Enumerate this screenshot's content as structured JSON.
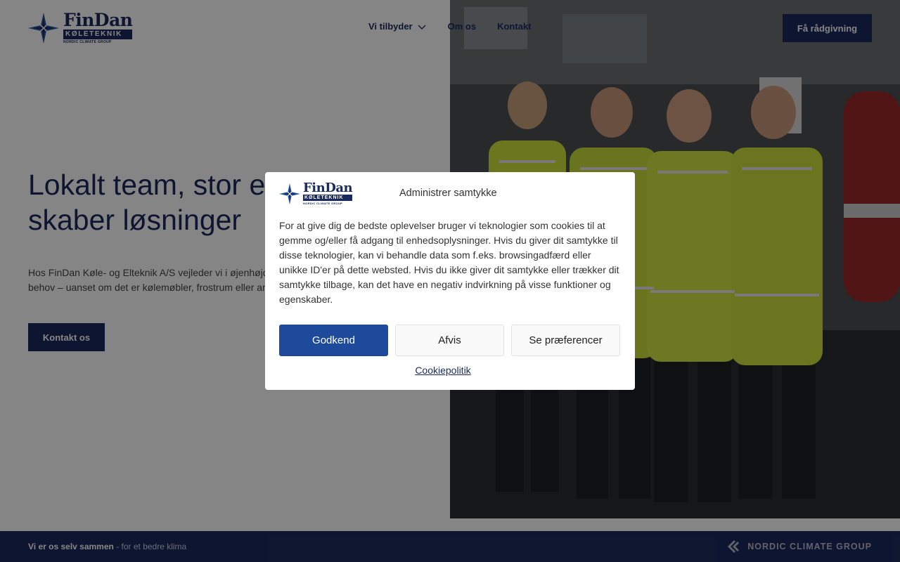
{
  "header": {
    "brand": "FinDan",
    "brand_sub": "KØLETEKNIK",
    "brand_group": "NORDIC CLIMATE GROUP",
    "nav": [
      {
        "label": "Vi tilbyder",
        "has_dropdown": true
      },
      {
        "label": "Om os"
      },
      {
        "label": "Kontakt"
      }
    ],
    "cta_label": "Få rådgivning"
  },
  "hero": {
    "title": "Lokalt team, stor erfaring – vi skaber løsninger",
    "text": "Hos FinDan Køle- og Elteknik A/S vejleder vi i øjenhøjde og finder den rette løsning til dit behov – uanset om det er kølemøbler, frostrum eller andre køleløsninger.",
    "button_label": "Kontakt os"
  },
  "footer": {
    "tagline_bold": "Vi er os selv sammen",
    "tagline_rest": " - for et bedre klima",
    "group_logo_text": "NORDIC CLIMATE GROUP"
  },
  "consent": {
    "title": "Administrer samtykke",
    "body": "For at give dig de bedste oplevelser bruger vi teknologier som cookies til at gemme og/eller få adgang til enhedsoplysninger. Hvis du giver dit samtykke til disse teknologier, kan vi behandle data som f.eks. browsingadfærd eller unikke ID'er på dette websted. Hvis du ikke giver dit samtykke eller trækker dit samtykke tilbage, kan det have en negativ indvirkning på visse funktioner og egenskaber.",
    "accept_label": "Godkend",
    "deny_label": "Afvis",
    "preferences_label": "Se præferencer",
    "policy_link": "Cookiepolitik"
  },
  "colors": {
    "brand_navy": "#1b2a5c",
    "accept_blue": "#1e4a9c",
    "vest_yellow": "#c9e13a"
  },
  "icons": [
    "findan-logo-icon",
    "chevron-down-icon",
    "nordic-climate-group-icon"
  ]
}
